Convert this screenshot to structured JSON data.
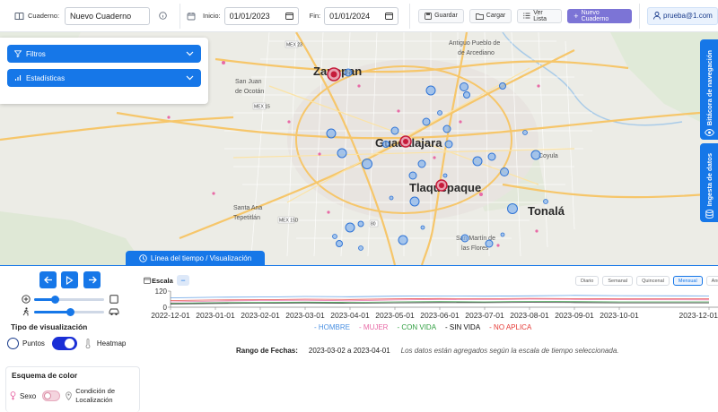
{
  "toolbar": {
    "notebook_label": "Cuaderno:",
    "notebook_value": "Nuevo Cuaderno",
    "start_label": "Inicio:",
    "start_value": "01/01/2023",
    "end_label": "Fin:",
    "end_value": "01/01/2024",
    "save_label": "Guardar",
    "load_label": "Cargar",
    "list_label": "Ver Lista",
    "new_label": "Nuevo Cuaderno",
    "user_label": "prueba@1.com"
  },
  "map_panel": {
    "filters_label": "Filtros",
    "stats_label": "Estadísticas"
  },
  "map_labels": [
    {
      "text": "Zapopan",
      "kind": "city"
    },
    {
      "text": "Guadalajara",
      "kind": "city"
    },
    {
      "text": "Tlaquepaque",
      "kind": "city"
    },
    {
      "text": "Tonalá",
      "kind": "city"
    },
    {
      "text": "San Juan de Ocotán",
      "kind": "town"
    },
    {
      "text": "Santa Ana Tepetitlán",
      "kind": "town"
    },
    {
      "text": "Antiguo Pueblo de Arcediano",
      "kind": "town"
    },
    {
      "text": "Coyula",
      "kind": "town"
    },
    {
      "text": "San Martín de las Flores",
      "kind": "town"
    },
    {
      "text": "MEX 15",
      "kind": "road"
    },
    {
      "text": "MEX 15D",
      "kind": "road"
    },
    {
      "text": "MEX 23",
      "kind": "road"
    },
    {
      "text": "80",
      "kind": "road"
    }
  ],
  "side_tabs": {
    "nav_log": "Bitácora de navegación",
    "data_ingest": "Ingesta de datos"
  },
  "timeline_tab": "Línea del tiempo / Visualización",
  "timeline": {
    "scale_label": "Escala",
    "scale_options": [
      "Diario",
      "Semanal",
      "Quincenal",
      "Mensual",
      "Anual"
    ],
    "active_scale": "Mensual",
    "range_label": "Rango de Fechas:",
    "range_value": "2023-03-02 a 2023-04-01",
    "note": "Los datos están agregados según la escala de tiempo seleccionada."
  },
  "viz": {
    "type_title": "Tipo de visualización",
    "points_label": "Puntos",
    "heatmap_label": "Heatmap",
    "color_title": "Esquema de color",
    "sex_label": "Sexo",
    "location_label": "Condición de Localización"
  },
  "colors": {
    "accent": "#1677e8",
    "primary_button": "#7c74d6",
    "hombre": "#4a90e2",
    "mujer": "#e86aa6",
    "con_vida": "#2e9e3f",
    "sin_vida": "#111111",
    "no_aplica": "#e53935"
  },
  "chart_data": {
    "type": "line",
    "x": [
      "2022-12-01",
      "2023-01-01",
      "2023-02-01",
      "2023-03-01",
      "2023-04-01",
      "2023-05-01",
      "2023-06-01",
      "2023-07-01",
      "2023-08-01",
      "2023-09-01",
      "2023-10-01",
      "2023-12-01"
    ],
    "ylim": [
      0,
      120
    ],
    "yticks": [
      0,
      120
    ],
    "series": [
      {
        "name": "HOMBRE",
        "values": [
          70,
          74,
          76,
          80,
          78,
          82,
          84,
          82,
          85,
          88,
          86,
          84
        ]
      },
      {
        "name": "MUJER",
        "values": [
          40,
          46,
          50,
          52,
          48,
          54,
          58,
          56,
          60,
          58,
          56,
          55
        ]
      },
      {
        "name": "CON VIDA",
        "values": [
          30,
          34,
          36,
          38,
          36,
          40,
          42,
          40,
          44,
          42,
          40,
          40
        ]
      },
      {
        "name": "SIN VIDA",
        "values": [
          25,
          28,
          30,
          32,
          30,
          33,
          35,
          34,
          36,
          35,
          33,
          33
        ]
      },
      {
        "name": "NO APLICA",
        "values": [
          50,
          54,
          56,
          60,
          58,
          62,
          65,
          63,
          66,
          64,
          62,
          62
        ]
      }
    ]
  }
}
